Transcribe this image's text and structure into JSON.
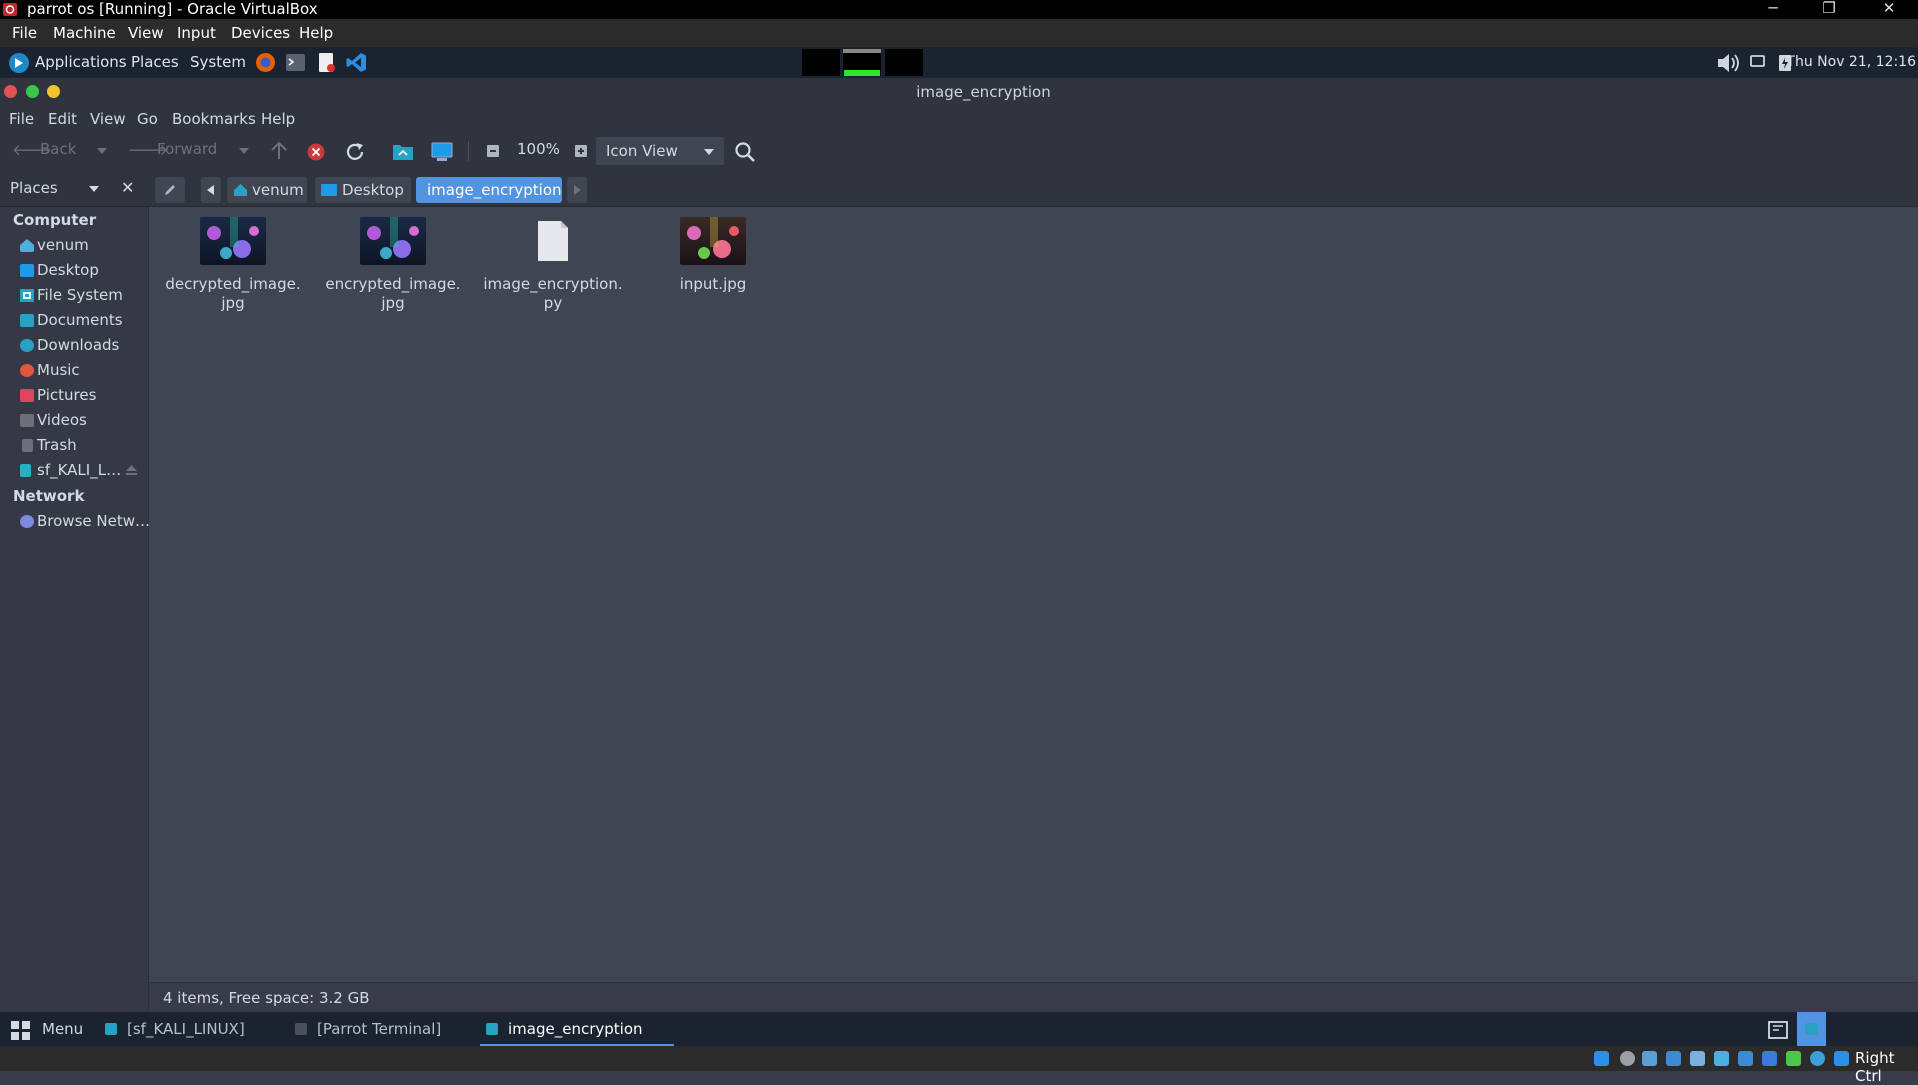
{
  "host_window": {
    "title": "parrot os [Running] - Oracle VirtualBox",
    "menu": [
      "File",
      "Machine",
      "View",
      "Input",
      "Devices",
      "Help"
    ],
    "controls": {
      "minimize": "─",
      "restore": "❐",
      "close": "✕"
    }
  },
  "top_panel": {
    "menus": [
      "Applications",
      "Places",
      "System"
    ],
    "launchers": [
      "firefox-icon",
      "terminal-icon",
      "text-editor-icon",
      "vscode-icon"
    ],
    "clock": "Thu Nov 21, 12:16"
  },
  "window": {
    "title": "image_encryption",
    "menu": [
      "File",
      "Edit",
      "View",
      "Go",
      "Bookmarks",
      "Help"
    ]
  },
  "toolbar": {
    "back": "Back",
    "forward": "Forward",
    "zoom": "100%",
    "view_mode": "Icon View"
  },
  "sidebar": {
    "header": "Places",
    "sections": [
      {
        "title": "Computer",
        "items": [
          {
            "label": "venum",
            "icon": "home-icon",
            "color": "#4fb0e0"
          },
          {
            "label": "Desktop",
            "icon": "desktop-folder-icon",
            "color": "#1e9be8"
          },
          {
            "label": "File System",
            "icon": "drive-icon",
            "color": "#27a2c4"
          },
          {
            "label": "Documents",
            "icon": "documents-folder-icon",
            "color": "#27a2c4"
          },
          {
            "label": "Downloads",
            "icon": "downloads-icon",
            "color": "#27a2c4"
          },
          {
            "label": "Music",
            "icon": "music-icon",
            "color": "#e0583c"
          },
          {
            "label": "Pictures",
            "icon": "pictures-icon",
            "color": "#e0445f"
          },
          {
            "label": "Videos",
            "icon": "videos-icon",
            "color": "#6a6f7a"
          },
          {
            "label": "Trash",
            "icon": "trash-icon",
            "color": "#6a6f7a"
          },
          {
            "label": "sf_KALI_L…",
            "icon": "shared-folder-icon",
            "color": "#27b0c4"
          }
        ]
      },
      {
        "title": "Network",
        "items": [
          {
            "label": "Browse Netw…",
            "icon": "network-icon",
            "color": "#7b8ce0"
          }
        ]
      }
    ]
  },
  "breadcrumbs": [
    "venum",
    "Desktop",
    "image_encryption"
  ],
  "files": [
    {
      "name": "decrypted_image.jpg",
      "line1": "decrypted_image.",
      "line2": "jpg",
      "type": "image"
    },
    {
      "name": "encrypted_image.jpg",
      "line1": "encrypted_image.",
      "line2": "jpg",
      "type": "image"
    },
    {
      "name": "image_encryption.py",
      "line1": "image_encryption.",
      "line2": "py",
      "type": "text"
    },
    {
      "name": "input.jpg",
      "line1": "input.jpg",
      "line2": "",
      "type": "image"
    }
  ],
  "status": "4 items, Free space: 3.2 GB",
  "taskbar": {
    "menu": "Menu",
    "tasks": [
      {
        "label": "[sf_KALI_LINUX]",
        "active": false
      },
      {
        "label": "[Parrot Terminal]",
        "active": false
      },
      {
        "label": "image_encryption",
        "active": true
      }
    ]
  },
  "vb_status": {
    "host_key": "Right Ctrl"
  },
  "colors": {
    "accent": "#5294e2",
    "panel": "#1c2330",
    "window_bg": "#404552",
    "sidebar_bg": "#353945"
  }
}
